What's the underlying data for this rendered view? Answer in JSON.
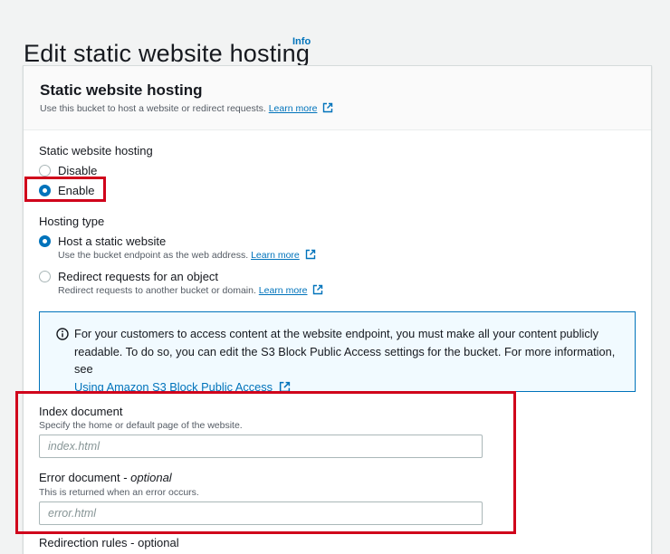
{
  "page": {
    "title": "Edit static website hosting",
    "info_link": "Info"
  },
  "panel": {
    "title": "Static website hosting",
    "description": "Use this bucket to host a website or redirect requests.",
    "learn_more": "Learn more"
  },
  "hosting": {
    "label": "Static website hosting",
    "options": [
      {
        "label": "Disable",
        "checked": false
      },
      {
        "label": "Enable",
        "checked": true
      }
    ]
  },
  "hosting_type": {
    "label": "Hosting type",
    "options": [
      {
        "label": "Host a static website",
        "description": "Use the bucket endpoint as the web address.",
        "learn_more": "Learn more",
        "checked": true
      },
      {
        "label": "Redirect requests for an object",
        "description": "Redirect requests to another bucket or domain.",
        "learn_more": "Learn more",
        "checked": false
      }
    ]
  },
  "info_alert": {
    "text": "For your customers to access content at the website endpoint, you must make all your content publicly readable. To do so, you can edit the S3 Block Public Access settings for the bucket. For more information, see",
    "link": "Using Amazon S3 Block Public Access"
  },
  "index_document": {
    "label": "Index document",
    "description": "Specify the home or default page of the website.",
    "placeholder": "index.html"
  },
  "error_document": {
    "label": "Error document - ",
    "optional": "optional",
    "description": "This is returned when an error occurs.",
    "placeholder": "error.html"
  },
  "redirection_rules": {
    "label": "Redirection rules - optional"
  },
  "colors": {
    "link": "#0073bb",
    "highlight": "#d0021b",
    "info_bg": "#f1faff"
  }
}
